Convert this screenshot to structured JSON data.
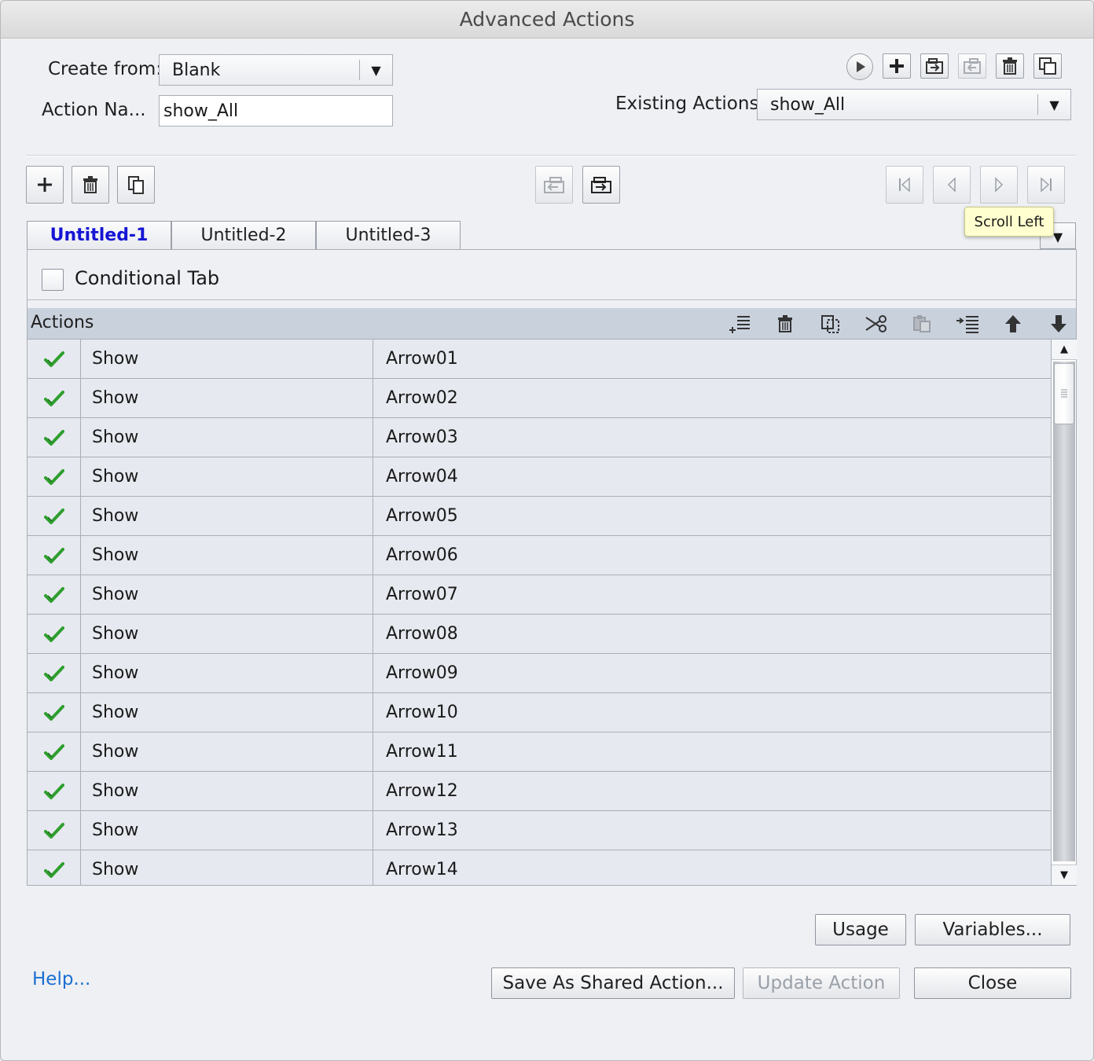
{
  "window": {
    "title": "Advanced Actions"
  },
  "header": {
    "create_from_label": "Create from:",
    "create_from_value": "Blank",
    "action_name_label": "Action Na...",
    "action_name_value": "show_All",
    "existing_actions_label": "Existing Actions:",
    "existing_actions_value": "show_All"
  },
  "tabs": [
    {
      "label": "Untitled-1",
      "active": true
    },
    {
      "label": "Untitled-2",
      "active": false
    },
    {
      "label": "Untitled-3",
      "active": false
    }
  ],
  "tooltip": "Scroll Left",
  "conditional_tab_label": "Conditional Tab",
  "actions_header": "Actions",
  "rows": [
    {
      "action": "Show",
      "target": "Arrow01"
    },
    {
      "action": "Show",
      "target": "Arrow02"
    },
    {
      "action": "Show",
      "target": "Arrow03"
    },
    {
      "action": "Show",
      "target": "Arrow04"
    },
    {
      "action": "Show",
      "target": "Arrow05"
    },
    {
      "action": "Show",
      "target": "Arrow06"
    },
    {
      "action": "Show",
      "target": "Arrow07"
    },
    {
      "action": "Show",
      "target": "Arrow08"
    },
    {
      "action": "Show",
      "target": "Arrow09"
    },
    {
      "action": "Show",
      "target": "Arrow10"
    },
    {
      "action": "Show",
      "target": "Arrow11"
    },
    {
      "action": "Show",
      "target": "Arrow12"
    },
    {
      "action": "Show",
      "target": "Arrow13"
    },
    {
      "action": "Show",
      "target": "Arrow14"
    }
  ],
  "buttons": {
    "usage": "Usage",
    "variables": "Variables...",
    "save_shared": "Save As Shared Action...",
    "update": "Update Action",
    "close": "Close",
    "help": "Help..."
  },
  "colors": {
    "check_green": "#2e9e2e",
    "active_tab": "#1515d4",
    "help_link": "#1c6fd0",
    "actions_bar": "#c9d1dd"
  }
}
